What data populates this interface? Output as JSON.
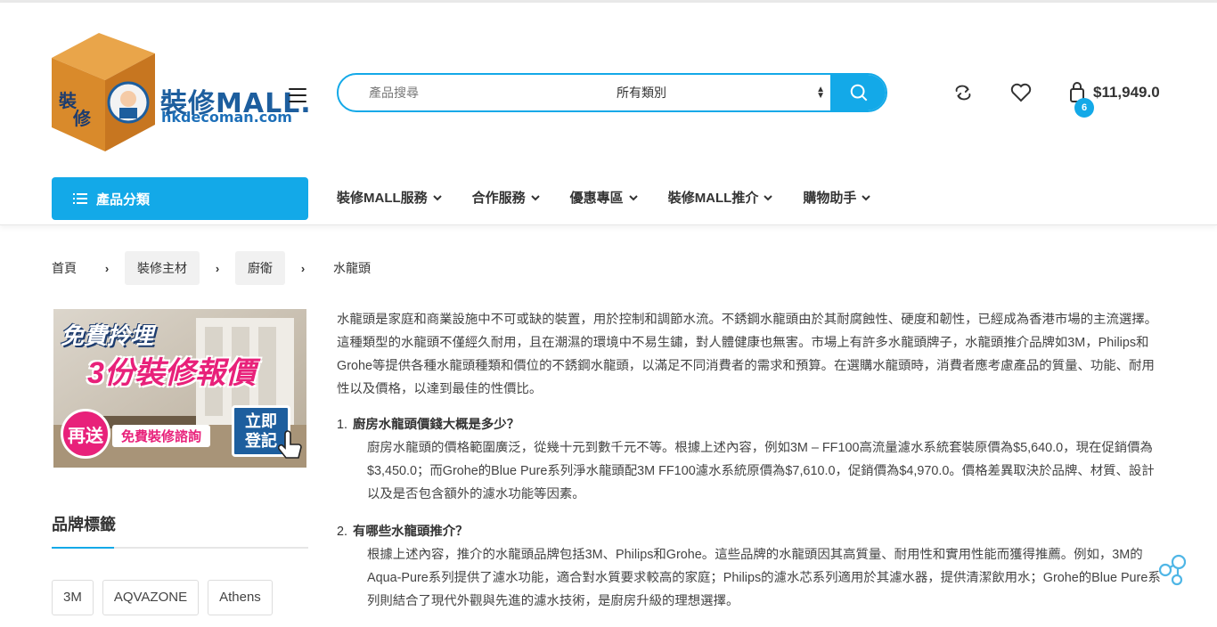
{
  "header": {
    "logo_text": "裝修MALL.",
    "logo_sub": "hkdecoman.com",
    "search": {
      "placeholder": "產品搜尋",
      "category": "所有類別"
    },
    "cart": {
      "count": "6",
      "total": "$11,949.0"
    },
    "category_button": "產品分類",
    "nav": [
      {
        "label": "裝修MALL服務"
      },
      {
        "label": "合作服務"
      },
      {
        "label": "優惠專區"
      },
      {
        "label": "裝修MALL推介"
      },
      {
        "label": "購物助手"
      }
    ]
  },
  "breadcrumb": [
    "首頁",
    "裝修主材",
    "廚衛",
    "水龍頭"
  ],
  "banner": {
    "line1": "免費拎埋",
    "line2": "3份裝修報價",
    "badge": "再送",
    "badge_text": "免費裝修諮詢",
    "cta1": "立即",
    "cta2": "登記"
  },
  "sidebar": {
    "brand_title": "品牌標籤",
    "tags": [
      "3M",
      "AQVAZONE",
      "Athens"
    ]
  },
  "content": {
    "intro": "水龍頭是家庭和商業設施中不可或缺的裝置，用於控制和調節水流。不銹鋼水龍頭由於其耐腐蝕性、硬度和韌性，已經成為香港市場的主流選擇。這種類型的水龍頭不僅經久耐用，且在潮濕的環境中不易生鏽，對人體健康也無害。市場上有許多水龍頭牌子，水龍頭推介品牌如3M，Philips和Grohe等提供各種水龍頭種類和價位的不銹鋼水龍頭，以滿足不同消費者的需求和預算。在選購水龍頭時，消費者應考慮產品的質量、功能、耐用性以及價格，以達到最佳的性價比。",
    "qa": [
      {
        "num": "1.",
        "q": "廚房水龍頭價錢大概是多少？",
        "a": "廚房水龍頭的價格範圍廣泛，從幾十元到數千元不等。根據上述內容，例如3M – FF100高流量濾水系統套裝原價為$5,640.0，現在促銷價為$3,450.0；而Grohe的Blue Pure系列淨水龍頭配3M FF100濾水系統原價為$7,610.0，促銷價為$4,970.0。價格差異取決於品牌、材質、設計以及是否包含額外的濾水功能等因素。"
      },
      {
        "num": "2.",
        "q": "有哪些水龍頭推介？",
        "a": "根據上述內容，推介的水龍頭品牌包括3M、Philips和Grohe。這些品牌的水龍頭因其高質量、耐用性和實用性能而獲得推薦。例如，3M的Aqua-Pure系列提供了濾水功能，適合對水質要求較高的家庭；Philips的濾水芯系列適用於其濾水器，提供清潔飲用水；Grohe的Blue Pure系列則結合了現代外觀與先進的濾水技術，是廚房升級的理想選擇。"
      }
    ]
  },
  "colors": {
    "accent": "#13a9e8",
    "logo_blue": "#1d5e9e",
    "banner_pink": "#e8217a"
  }
}
